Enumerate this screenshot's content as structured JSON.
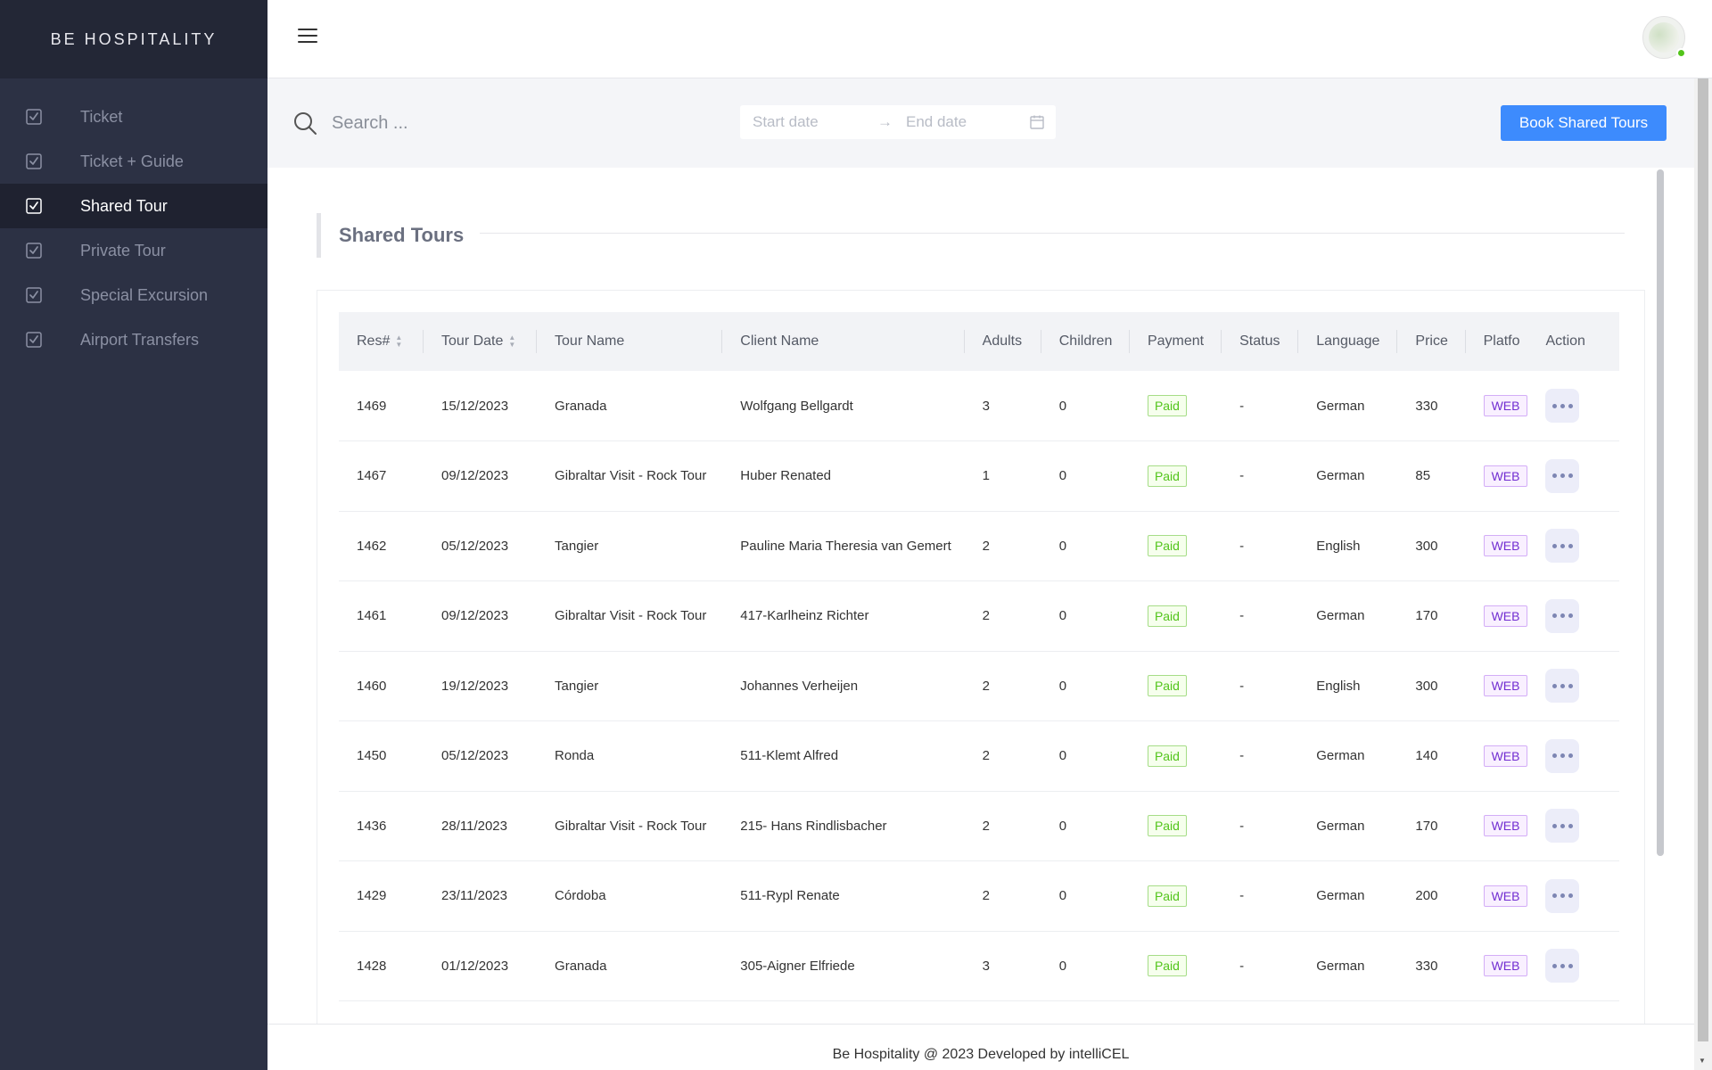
{
  "app": {
    "brand": "BE HOSPITALITY"
  },
  "sidebar": {
    "items": [
      {
        "label": "Ticket",
        "active": false
      },
      {
        "label": "Ticket + Guide",
        "active": false
      },
      {
        "label": "Shared Tour",
        "active": true
      },
      {
        "label": "Private Tour",
        "active": false
      },
      {
        "label": "Special Excursion",
        "active": false
      },
      {
        "label": "Airport Transfers",
        "active": false
      }
    ]
  },
  "toolbar": {
    "search_placeholder": "Search ...",
    "start_placeholder": "Start date",
    "end_placeholder": "End date",
    "book_button": "Book Shared Tours"
  },
  "section": {
    "title": "Shared Tours"
  },
  "table": {
    "columns": [
      "Res#",
      "Tour Date",
      "Tour Name",
      "Client Name",
      "Adults",
      "Children",
      "Payment",
      "Status",
      "Language",
      "Price",
      "Platfo",
      "Action"
    ],
    "rows": [
      {
        "res": "1469",
        "date": "15/12/2023",
        "tour": "Granada",
        "client": "Wolfgang Bellgardt",
        "adults": "3",
        "children": "0",
        "payment": "Paid",
        "status": "-",
        "language": "German",
        "price": "330",
        "platform": "WEB"
      },
      {
        "res": "1467",
        "date": "09/12/2023",
        "tour": "Gibraltar Visit - Rock Tour",
        "client": "Huber Renated",
        "adults": "1",
        "children": "0",
        "payment": "Paid",
        "status": "-",
        "language": "German",
        "price": "85",
        "platform": "WEB"
      },
      {
        "res": "1462",
        "date": "05/12/2023",
        "tour": "Tangier",
        "client": "Pauline Maria Theresia van Gemert",
        "adults": "2",
        "children": "0",
        "payment": "Paid",
        "status": "-",
        "language": "English",
        "price": "300",
        "platform": "WEB"
      },
      {
        "res": "1461",
        "date": "09/12/2023",
        "tour": "Gibraltar Visit - Rock Tour",
        "client": "417-Karlheinz Richter",
        "adults": "2",
        "children": "0",
        "payment": "Paid",
        "status": "-",
        "language": "German",
        "price": "170",
        "platform": "WEB"
      },
      {
        "res": "1460",
        "date": "19/12/2023",
        "tour": "Tangier",
        "client": "Johannes Verheijen",
        "adults": "2",
        "children": "0",
        "payment": "Paid",
        "status": "-",
        "language": "English",
        "price": "300",
        "platform": "WEB"
      },
      {
        "res": "1450",
        "date": "05/12/2023",
        "tour": "Ronda",
        "client": "511-Klemt Alfred",
        "adults": "2",
        "children": "0",
        "payment": "Paid",
        "status": "-",
        "language": "German",
        "price": "140",
        "platform": "WEB"
      },
      {
        "res": "1436",
        "date": "28/11/2023",
        "tour": "Gibraltar Visit - Rock Tour",
        "client": "215- Hans Rindlisbacher",
        "adults": "2",
        "children": "0",
        "payment": "Paid",
        "status": "-",
        "language": "German",
        "price": "170",
        "platform": "WEB"
      },
      {
        "res": "1429",
        "date": "23/11/2023",
        "tour": "Córdoba",
        "client": "511-Rypl Renate",
        "adults": "2",
        "children": "0",
        "payment": "Paid",
        "status": "-",
        "language": "German",
        "price": "200",
        "platform": "WEB"
      },
      {
        "res": "1428",
        "date": "01/12/2023",
        "tour": "Granada",
        "client": "305-Aigner Elfriede",
        "adults": "3",
        "children": "0",
        "payment": "Paid",
        "status": "-",
        "language": "German",
        "price": "330",
        "platform": "WEB"
      }
    ]
  },
  "footer": {
    "text": "Be Hospitality @ 2023 Developed by intelliCEL"
  },
  "colors": {
    "primary": "#3d8bfd",
    "sidebar": "#2c3144",
    "paid": "#52c41a",
    "web": "#722ed1"
  },
  "icons": {
    "nav": "checkbox-icon",
    "search": "search-icon",
    "calendar": "calendar-icon",
    "menu": "hamburger-icon",
    "action": "more-dots-icon"
  }
}
